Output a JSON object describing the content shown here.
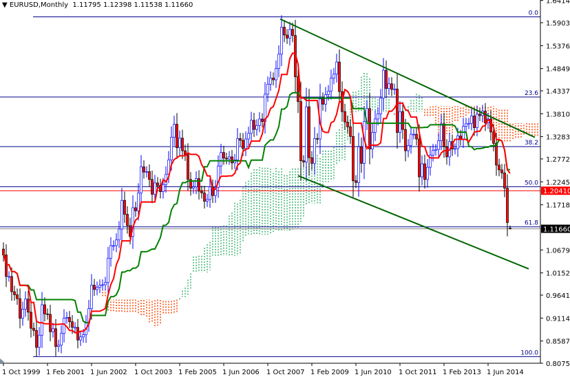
{
  "header": {
    "symbol_timeframe": "EURUSD,Monthly",
    "ohlc": "1.11795 1.12398 1.11538 1.11660"
  },
  "chart_data": {
    "type": "candlestick",
    "title": "EURUSD,Monthly",
    "start_month": "1999-10",
    "ylim": [
      0.8,
      1.645
    ],
    "y_ticks": [
      "1.64145",
      "1.59030",
      "1.53760",
      "1.48490",
      "1.43375",
      "1.38105",
      "1.32835",
      "1.27720",
      "1.22450",
      "1.17180",
      "1.06795",
      "1.01525",
      "0.96410",
      "0.91140",
      "0.85870",
      "0.80755"
    ],
    "x_ticks": [
      {
        "label": "1 Oct 1999",
        "month": 0
      },
      {
        "label": "1 Feb 2001",
        "month": 16
      },
      {
        "label": "1 Jun 2002",
        "month": 32
      },
      {
        "label": "1 Oct 2003",
        "month": 48
      },
      {
        "label": "1 Feb 2005",
        "month": 64
      },
      {
        "label": "1 Jun 2006",
        "month": 80
      },
      {
        "label": "1 Oct 2007",
        "month": 96
      },
      {
        "label": "1 Feb 2009",
        "month": 112
      },
      {
        "label": "1 Jun 2010",
        "month": 128
      },
      {
        "label": "1 Oct 2011",
        "month": 144
      },
      {
        "label": "1 Feb 2013",
        "month": 160
      },
      {
        "label": "1 Jun 2014",
        "month": 176
      }
    ],
    "first_open": 1.07,
    "closes": [
      1.0565,
      1.007,
      1.007,
      0.972,
      0.965,
      0.956,
      0.911,
      0.932,
      0.955,
      0.925,
      0.888,
      0.883,
      0.844,
      0.872,
      0.942,
      0.921,
      0.92,
      0.88,
      0.887,
      0.846,
      0.849,
      0.876,
      0.911,
      0.913,
      0.903,
      0.89,
      0.89,
      0.861,
      0.868,
      0.873,
      0.9,
      0.933,
      0.987,
      0.977,
      0.982,
      0.987,
      0.988,
      0.993,
      1.049,
      1.078,
      1.078,
      1.091,
      1.116,
      1.182,
      1.15,
      1.124,
      1.099,
      1.165,
      1.158,
      1.199,
      1.259,
      1.247,
      1.248,
      1.23,
      1.196,
      1.222,
      1.216,
      1.202,
      1.218,
      1.242,
      1.275,
      1.327,
      1.357,
      1.303,
      1.325,
      1.296,
      1.287,
      1.23,
      1.21,
      1.213,
      1.232,
      1.203,
      1.199,
      1.18,
      1.184,
      1.213,
      1.193,
      1.212,
      1.261,
      1.292,
      1.279,
      1.277,
      1.282,
      1.268,
      1.275,
      1.324,
      1.32,
      1.301,
      1.323,
      1.336,
      1.366,
      1.345,
      1.354,
      1.369,
      1.363,
      1.426,
      1.449,
      1.463,
      1.459,
      1.485,
      1.518,
      1.58,
      1.562,
      1.555,
      1.575,
      1.561,
      1.466,
      1.409,
      1.273,
      1.27,
      1.397,
      1.28,
      1.267,
      1.324,
      1.323,
      1.415,
      1.403,
      1.425,
      1.433,
      1.463,
      1.472,
      1.5,
      1.432,
      1.386,
      1.362,
      1.351,
      1.329,
      1.227,
      1.223,
      1.305,
      1.267,
      1.363,
      1.393,
      1.3,
      1.338,
      1.369,
      1.381,
      1.417,
      1.481,
      1.439,
      1.45,
      1.437,
      1.438,
      1.338,
      1.386,
      1.345,
      1.296,
      1.308,
      1.334,
      1.334,
      1.323,
      1.236,
      1.266,
      1.23,
      1.258,
      1.286,
      1.297,
      1.299,
      1.319,
      1.358,
      1.305,
      1.282,
      1.317,
      1.3,
      1.301,
      1.33,
      1.322,
      1.352,
      1.358,
      1.359,
      1.376,
      1.349,
      1.38,
      1.377,
      1.387,
      1.36,
      1.369,
      1.339,
      1.313,
      1.263,
      1.252,
      1.245,
      1.21,
      1.131,
      1.1166
    ],
    "ichimoku": {
      "tenkan": 9,
      "kijun": 26,
      "senkou_b": 52
    },
    "fibonacci": {
      "high": 1.6038,
      "low": 0.8228,
      "levels": [
        "0.0",
        "23.6",
        "38.2",
        "50.0",
        "61.8",
        "100.0"
      ],
      "ratios": [
        0,
        0.236,
        0.382,
        0.5,
        0.618,
        1.0
      ]
    },
    "trendlines": [
      {
        "name": "upper-channel",
        "from": {
          "month": 100.5,
          "price": 1.5988
        },
        "to": {
          "month": 193,
          "price": 1.3268
        }
      },
      {
        "name": "lower-channel",
        "from": {
          "month": 107,
          "price": 1.2385
        },
        "to": {
          "month": 190.75,
          "price": 1.0245
        }
      }
    ],
    "price_markers": [
      {
        "label": "1.20410",
        "price": 1.2041,
        "color": "#ff0000"
      },
      {
        "label": "1.11660",
        "price": 1.1166,
        "color": "#000000"
      }
    ],
    "colors": {
      "bull": "#0000ff",
      "bear": "#ff0000",
      "tenkan": "#ff0000",
      "kijun": "#008000",
      "cloud_up": "#3cb371",
      "cloud_down": "#ff4500",
      "fib": "#00008b",
      "trend": "#006400"
    }
  }
}
